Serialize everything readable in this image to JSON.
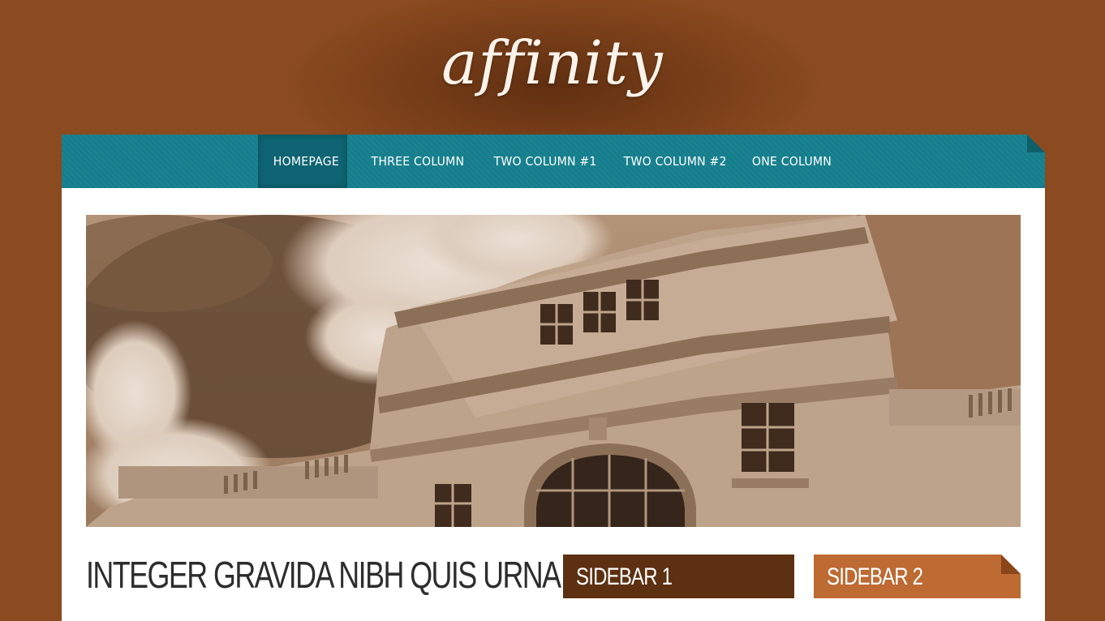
{
  "header": {
    "logo_text": "affinity"
  },
  "nav": {
    "items": [
      {
        "label": "HOMEPAGE",
        "active": true
      },
      {
        "label": "THREE COLUMN",
        "active": false
      },
      {
        "label": "TWO COLUMN #1",
        "active": false
      },
      {
        "label": "TWO COLUMN #2",
        "active": false
      },
      {
        "label": "ONE COLUMN",
        "active": false
      }
    ]
  },
  "main": {
    "post_title": "INTEGER GRAVIDA NIBH QUIS URNA"
  },
  "sidebars": {
    "sidebar1_title": "SIDEBAR 1",
    "sidebar2_title": "SIDEBAR 2"
  },
  "colors": {
    "background": "#8b4a1f",
    "nav": "#157e8c",
    "nav_active": "#0e6472",
    "sidebar1": "#5c3011",
    "sidebar2": "#bd6a33"
  }
}
